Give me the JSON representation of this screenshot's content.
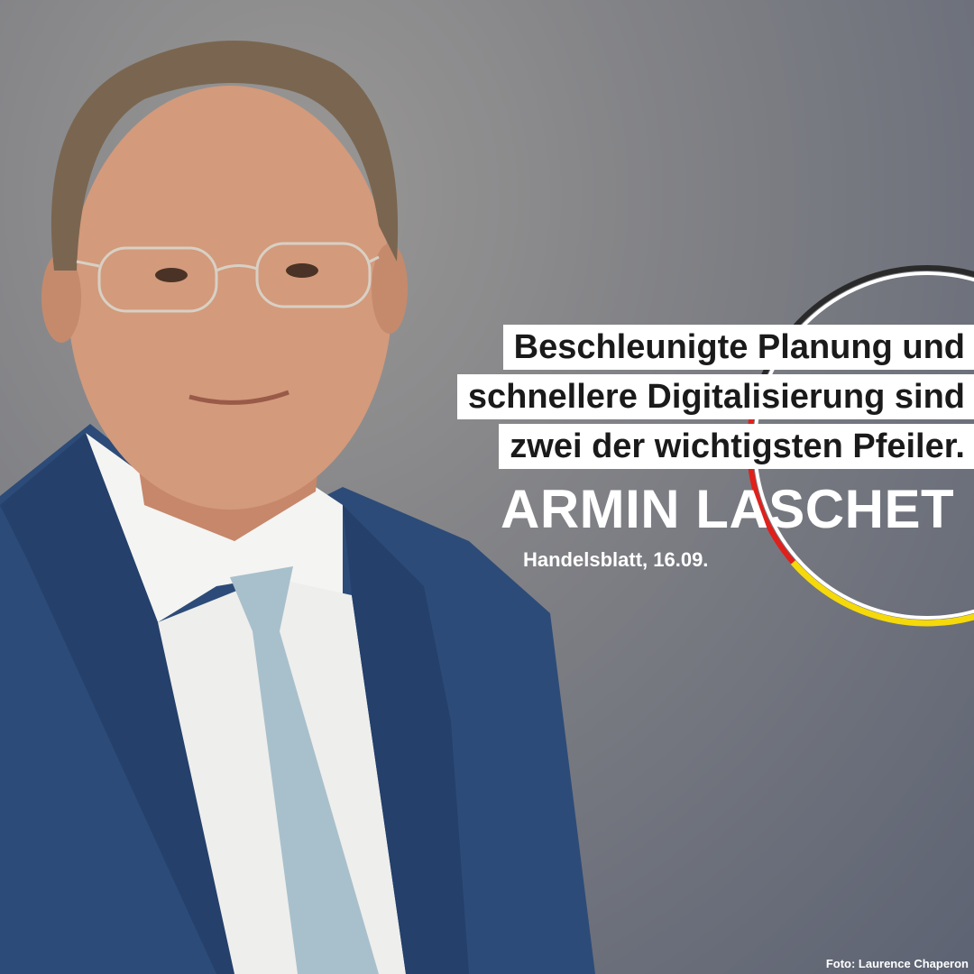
{
  "quote": {
    "lines": [
      "Beschleunigte Planung und",
      "schnellere Digitalisierung sind",
      "zwei der wichtigsten Pfeiler."
    ]
  },
  "speaker": "ARMIN LASCHET",
  "source": "Handelsblatt, 16.09.",
  "photo_credit": "Foto: Laurence Chaperon",
  "colors": {
    "ring_black": "#2a2a2a",
    "ring_red": "#e0201b",
    "ring_gold": "#f5d90a",
    "suit": "#2c4a78"
  }
}
